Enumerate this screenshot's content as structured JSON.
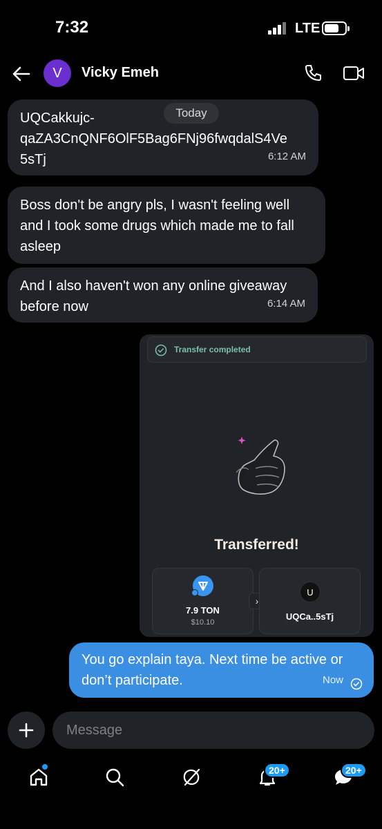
{
  "status_bar": {
    "time": "7:32",
    "network": "LTE"
  },
  "header": {
    "avatar_initial": "V",
    "contact_name": "Vicky Emeh"
  },
  "date_separator": "Today",
  "messages": [
    {
      "text": "UQCakkujc-\nqaZA3CnQNF6OlF5Bag6FNj96fwqdalS4Ve\n5sTj",
      "time": "6:12 AM"
    },
    {
      "text": "Boss don't be angry pls, I wasn't feeling well and I took some drugs which made me to fall asleep"
    },
    {
      "text": "And I also haven't won any online giveaway before now",
      "time": "6:14 AM"
    }
  ],
  "transfer_card": {
    "status": "Transfer completed",
    "title": "Transferred!",
    "amount": "7.9 TON",
    "usd": "$10.10",
    "recipient_initial": "U",
    "recipient_address": "UQCa..5sTj",
    "status_color": "#7fbfa7"
  },
  "outgoing_message": {
    "text": "You go explain taya. Next time be active or don’t participate.",
    "time": "Now"
  },
  "composer": {
    "placeholder": "Message"
  },
  "bottom_nav": {
    "items": [
      {
        "icon": "home-icon"
      },
      {
        "icon": "search-icon"
      },
      {
        "icon": "grok-icon"
      },
      {
        "icon": "bell-icon",
        "badge": "20+"
      },
      {
        "icon": "messages-icon",
        "badge": "20+"
      }
    ]
  },
  "colors": {
    "accent": "#1d9bf0",
    "outgoing_bubble": "#3b8fe2",
    "incoming_bubble": "#202327",
    "avatar": "#6b2fd0"
  }
}
